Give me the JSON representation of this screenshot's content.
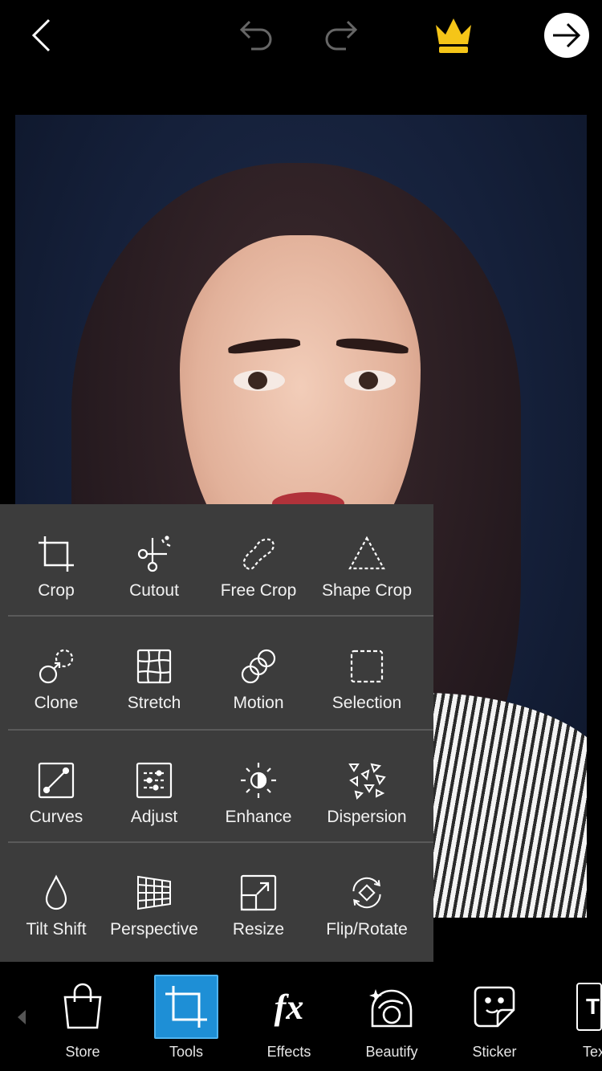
{
  "topbar": {
    "back_icon": "chevron-left-icon",
    "undo_icon": "undo-icon",
    "redo_icon": "redo-icon",
    "premium_icon": "crown-icon",
    "next_icon": "arrow-right-icon",
    "crown_color": "#f5c518"
  },
  "tools": {
    "rows": [
      [
        {
          "label": "Crop",
          "icon": "crop-icon"
        },
        {
          "label": "Cutout",
          "icon": "cutout-scissors-icon"
        },
        {
          "label": "Free Crop",
          "icon": "free-crop-icon"
        },
        {
          "label": "Shape Crop",
          "icon": "shape-crop-triangle-icon"
        }
      ],
      [
        {
          "label": "Clone",
          "icon": "clone-icon"
        },
        {
          "label": "Stretch",
          "icon": "stretch-grid-icon"
        },
        {
          "label": "Motion",
          "icon": "motion-circles-icon"
        },
        {
          "label": "Selection",
          "icon": "selection-dashed-square-icon"
        }
      ],
      [
        {
          "label": "Curves",
          "icon": "curves-icon"
        },
        {
          "label": "Adjust",
          "icon": "adjust-sliders-icon"
        },
        {
          "label": "Enhance",
          "icon": "enhance-sun-icon"
        },
        {
          "label": "Dispersion",
          "icon": "dispersion-triangles-icon"
        }
      ],
      [
        {
          "label": "Tilt Shift",
          "icon": "tilt-shift-drop-icon"
        },
        {
          "label": "Perspective",
          "icon": "perspective-grid-icon"
        },
        {
          "label": "Resize",
          "icon": "resize-icon"
        },
        {
          "label": "Flip/Rotate",
          "icon": "flip-rotate-icon"
        }
      ]
    ]
  },
  "bottombar": {
    "items": [
      {
        "label": "Store",
        "icon": "shopping-bag-icon"
      },
      {
        "label": "Tools",
        "icon": "crop-tool-icon",
        "active": true
      },
      {
        "label": "Effects",
        "icon": "fx-icon",
        "glyph": "fx"
      },
      {
        "label": "Beautify",
        "icon": "beautify-face-icon"
      },
      {
        "label": "Sticker",
        "icon": "sticker-icon"
      },
      {
        "label": "Tex",
        "icon": "text-icon",
        "glyph": "T"
      }
    ],
    "active_color": "#1e8fd6"
  }
}
